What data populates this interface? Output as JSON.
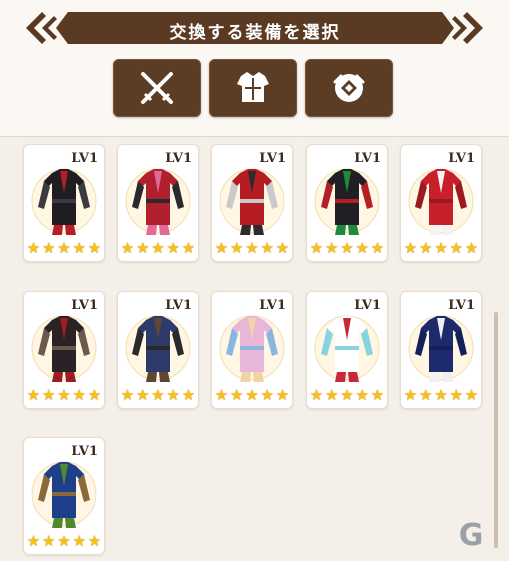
{
  "header": {
    "title": "交換する装備を選択"
  },
  "tabs": [
    {
      "name": "weapon",
      "icon": "crossed-swords-icon"
    },
    {
      "name": "armor",
      "icon": "armor-icon"
    },
    {
      "name": "accessory",
      "icon": "accessory-icon"
    }
  ],
  "star_glyph": "★",
  "cards": [
    {
      "level": "LV1",
      "stars": 5,
      "colors": [
        "#1e1e22",
        "#b31f24",
        "#3a3a40"
      ]
    },
    {
      "level": "LV1",
      "stars": 5,
      "colors": [
        "#b0202f",
        "#e06b94",
        "#2a2a2e"
      ]
    },
    {
      "level": "LV1",
      "stars": 5,
      "colors": [
        "#b51d22",
        "#2c2c30",
        "#c9c9c9"
      ]
    },
    {
      "level": "LV1",
      "stars": 5,
      "colors": [
        "#202024",
        "#1f8a3c",
        "#b31f24"
      ]
    },
    {
      "level": "LV1",
      "stars": 5,
      "colors": [
        "#c8202a",
        "#f3f3f3",
        "#9a1a20"
      ]
    },
    {
      "level": "LV1",
      "stars": 5,
      "colors": [
        "#2a2224",
        "#9c1c22",
        "#6b5a4a"
      ]
    },
    {
      "level": "LV1",
      "stars": 5,
      "colors": [
        "#2d3a6b",
        "#5e4632",
        "#2a2a2a"
      ]
    },
    {
      "level": "LV1",
      "stars": 5,
      "colors": [
        "#e8b6d9",
        "#f2d3a6",
        "#8ab7e0"
      ]
    },
    {
      "level": "LV1",
      "stars": 5,
      "colors": [
        "#ffffff",
        "#c8283a",
        "#86d3e2"
      ]
    },
    {
      "level": "LV1",
      "stars": 5,
      "colors": [
        "#1d2a6e",
        "#f0f0f0",
        "#14205a"
      ]
    },
    {
      "level": "LV1",
      "stars": 5,
      "colors": [
        "#1f3f8a",
        "#4f8a2c",
        "#8a6a3a"
      ]
    }
  ],
  "watermark": "G"
}
